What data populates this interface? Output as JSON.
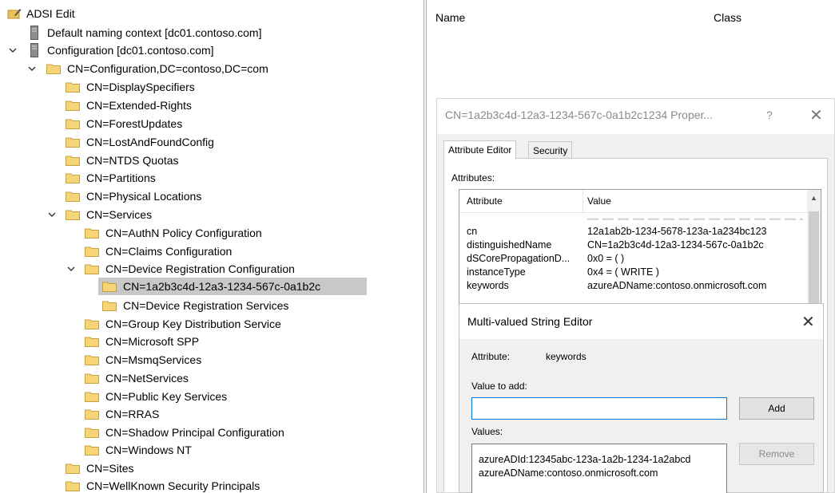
{
  "tree": {
    "root": "ADSI Edit",
    "default_ctx": "Default naming context [dc01.contoso.com]",
    "config": "Configuration [dc01.contoso.com]",
    "config_dn": "CN=Configuration,DC=contoso,DC=com",
    "config_children": [
      "CN=DisplaySpecifiers",
      "CN=Extended-Rights",
      "CN=ForestUpdates",
      "CN=LostAndFoundConfig",
      "CN=NTDS Quotas",
      "CN=Partitions",
      "CN=Physical Locations"
    ],
    "services": "CN=Services",
    "services_children_top": [
      "CN=AuthN Policy Configuration",
      "CN=Claims Configuration"
    ],
    "drc": "CN=Device Registration Configuration",
    "drc_children": [
      "CN=1a2b3c4d-12a3-1234-567c-0a1b2c",
      "CN=Device Registration Services"
    ],
    "services_children_bottom": [
      "CN=Group Key Distribution Service",
      "CN=Microsoft SPP",
      "CN=MsmqServices",
      "CN=NetServices",
      "CN=Public Key Services",
      "CN=RRAS",
      "CN=Shadow Principal Configuration",
      "CN=Windows NT"
    ],
    "tail": [
      "CN=Sites",
      "CN=WellKnown Security Principals"
    ]
  },
  "list_view": {
    "col_name": "Name",
    "col_class": "Class"
  },
  "props_dialog": {
    "title": "CN=1a2b3c4d-12a3-1234-567c-0a1b2c1234 Proper...",
    "help": "?",
    "close": "✕",
    "tabs": [
      "Attribute Editor",
      "Security"
    ],
    "attributes_label": "Attributes:",
    "col_attribute": "Attribute",
    "col_value": "Value",
    "rows": [
      {
        "name": "cn",
        "value": "12a1ab2b-1234-5678-123a-1a234bc123"
      },
      {
        "name": "distinguishedName",
        "value": "CN=1a2b3c4d-12a3-1234-567c-0a1b2c"
      },
      {
        "name": "dSCorePropagationD...",
        "value": "0x0 = ( )"
      },
      {
        "name": "instanceType",
        "value": "0x4 = ( WRITE )"
      },
      {
        "name": "keywords",
        "value": "azureADName:contoso.onmicrosoft.com"
      }
    ]
  },
  "mv_editor": {
    "title": "Multi-valued String Editor",
    "close": "✕",
    "attribute_label": "Attribute:",
    "attribute_value": "keywords",
    "value_to_add_label": "Value to add:",
    "value_to_add": "",
    "add_label": "Add",
    "values_label": "Values:",
    "remove_label": "Remove",
    "values": [
      "azureADId:12345abc-123a-1a2b-1234-1a2abcd",
      "azureADName:contoso.onmicrosoft.com"
    ]
  }
}
